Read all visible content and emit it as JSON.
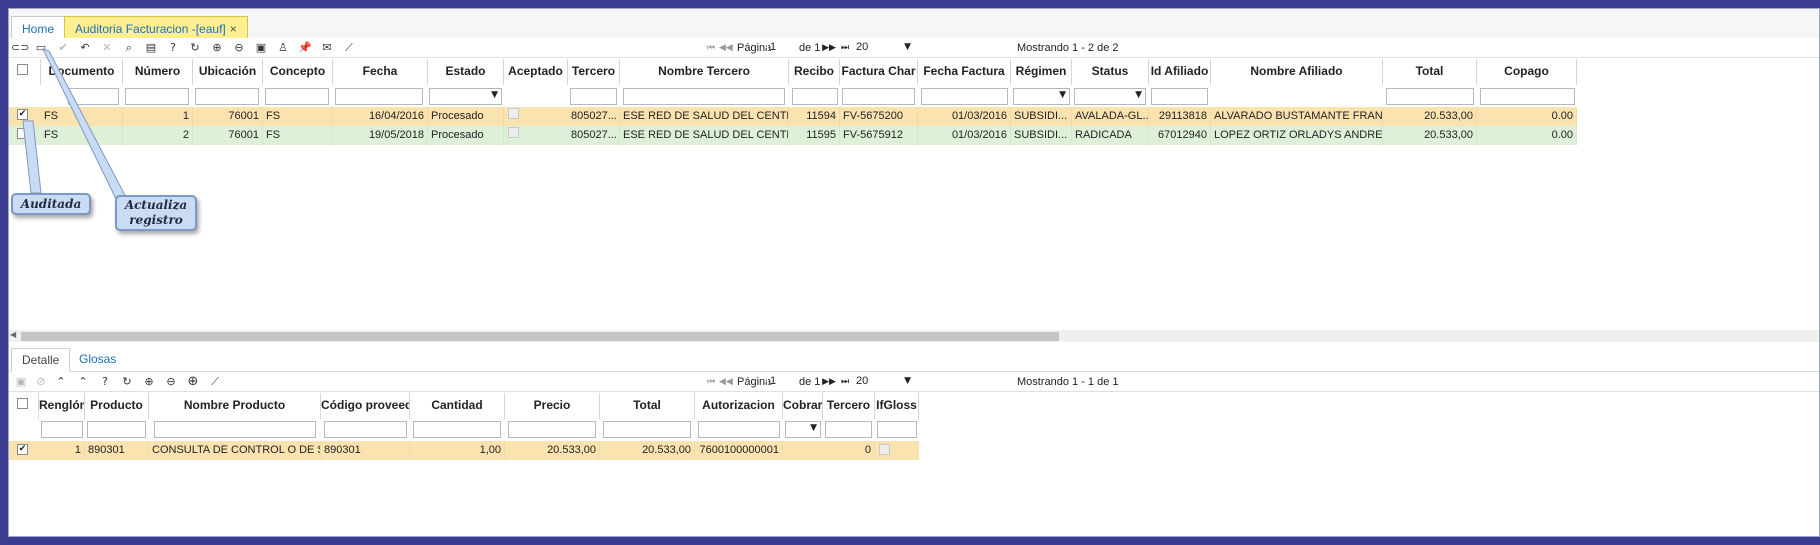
{
  "tabs": [
    {
      "label": "Home"
    },
    {
      "label": "Auditoria Facturacion -[eauf]",
      "close": "×"
    }
  ],
  "main": {
    "pager": {
      "page_label": "Página",
      "page_value": "1",
      "of_label": "de 1",
      "page_size": "20",
      "status": "Mostrando 1 - 2 de 2"
    },
    "columns": [
      "Documento",
      "Número",
      "Ubicación",
      "Concepto",
      "Fecha",
      "Estado",
      "Aceptado",
      "Tercero",
      "Nombre Tercero",
      "Recibo",
      "Factura Char",
      "Fecha Factura",
      "Régimen",
      "Status",
      "Id Afiliado",
      "Nombre Afiliado",
      "Total",
      "Copago"
    ],
    "rows": [
      {
        "documento": "FS",
        "numero": "1",
        "ubicacion": "76001",
        "concepto": "FS",
        "fecha": "16/04/2016",
        "estado": "Procesado",
        "tercero": "805027...",
        "nombre_tercero": "ESE RED DE SALUD DEL CENTR...",
        "recibo": "11594",
        "factura": "FV-5675200",
        "fecha_factura": "01/03/2016",
        "regimen": "SUBSIDI...",
        "status": "AVALADA-GL...",
        "id_afiliado": "29113818",
        "nombre_afiliado": "ALVARADO BUSTAMANTE FRANC...",
        "total": "20.533,00",
        "copago": "0.00"
      },
      {
        "documento": "FS",
        "numero": "2",
        "ubicacion": "76001",
        "concepto": "FS",
        "fecha": "19/05/2018",
        "estado": "Procesado",
        "tercero": "805027...",
        "nombre_tercero": "ESE RED DE SALUD DEL CENTR...",
        "recibo": "11595",
        "factura": "FV-5675912",
        "fecha_factura": "01/03/2016",
        "regimen": "SUBSIDI...",
        "status": "RADICADA",
        "id_afiliado": "67012940",
        "nombre_afiliado": "LOPEZ ORTIZ ORLADYS ANDREA",
        "total": "20.533,00",
        "copago": "0.00"
      }
    ]
  },
  "callouts": {
    "auditada": "Auditada",
    "actualiza": "Actualiza registro"
  },
  "subtabs": [
    {
      "label": "Detalle"
    },
    {
      "label": "Glosas"
    }
  ],
  "detail": {
    "pager": {
      "page_label": "Página",
      "page_value": "1",
      "of_label": "de 1",
      "page_size": "20",
      "status": "Mostrando 1 - 1 de 1"
    },
    "columns": [
      "Renglón",
      "Producto",
      "Nombre Producto",
      "Código proveedor",
      "Cantidad",
      "Precio",
      "Total",
      "Autorizacion",
      "Cobrar",
      "Tercero",
      "IfGloss"
    ],
    "rows": [
      {
        "renglon": "1",
        "producto": "890301",
        "nombre_producto": "CONSULTA DE CONTROL O DE SE...",
        "codigo": "890301",
        "cantidad": "1,00",
        "precio": "20.533,00",
        "total": "20.533,00",
        "autorizacion": "7600100000001",
        "tercero": "0"
      }
    ]
  },
  "colors": {
    "active_tab": "#ffef8f",
    "row_selected": "#fbe3b0",
    "row_alt": "#dff0d8",
    "link": "#1b6fb8",
    "frame": "#3b3b8f"
  }
}
